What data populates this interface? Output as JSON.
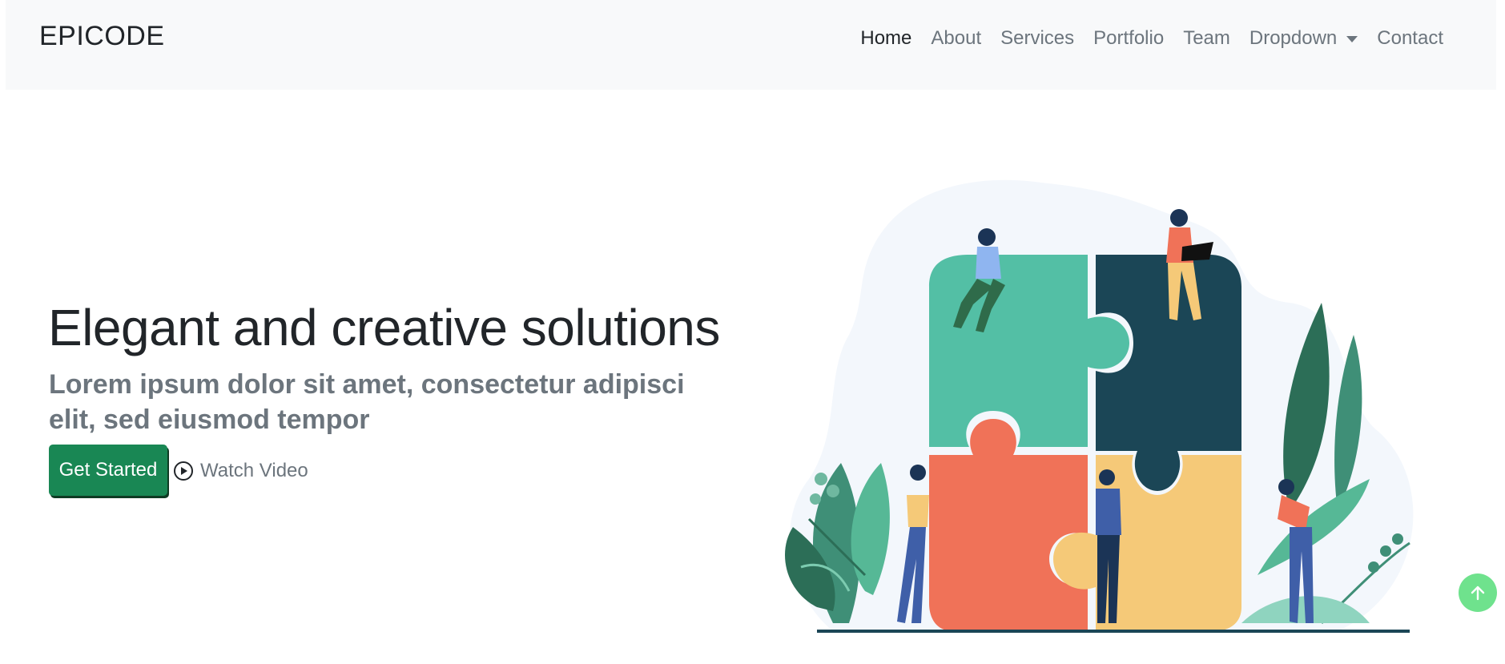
{
  "navbar": {
    "brand": "EPICODE",
    "items": [
      {
        "label": "Home",
        "active": true
      },
      {
        "label": "About"
      },
      {
        "label": "Services"
      },
      {
        "label": "Portfolio"
      },
      {
        "label": "Team"
      },
      {
        "label": "Dropdown",
        "has_caret": true
      },
      {
        "label": "Contact"
      }
    ]
  },
  "hero": {
    "title": "Elegant and creative solutions",
    "subtitle": "Lorem ipsum dolor sit amet, consectetur adipisci elit, sed eiusmod tempor",
    "primary_button": "Get Started",
    "video_link": "Watch Video"
  },
  "icons": {
    "play": "play-circle-icon",
    "back_to_top": "arrow-up-icon",
    "dropdown": "caret-down-icon"
  },
  "colors": {
    "navbar_bg": "#f8f9fa",
    "primary_button": "#198754",
    "muted_text": "#6c757d",
    "back_to_top": "#6fe28d"
  }
}
